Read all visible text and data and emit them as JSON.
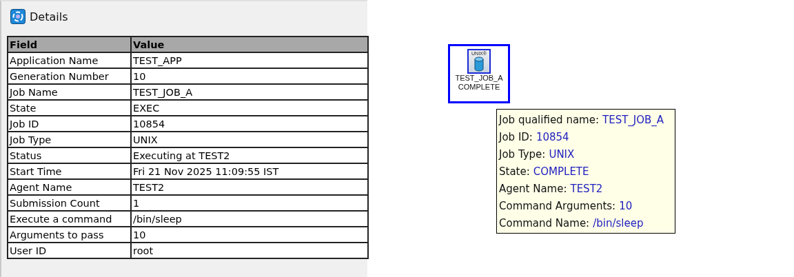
{
  "details": {
    "title": "Details",
    "columns": [
      "Field",
      "Value"
    ],
    "rows": [
      [
        "Application Name",
        "TEST_APP"
      ],
      [
        "Generation Number",
        "10"
      ],
      [
        "Job Name",
        "TEST_JOB_A"
      ],
      [
        "State",
        "EXEC"
      ],
      [
        "Job ID",
        "10854"
      ],
      [
        "Job Type",
        "UNIX"
      ],
      [
        "Status",
        "Executing at TEST2"
      ],
      [
        "Start Time",
        "Fri 21 Nov 2025 11:09:55 IST"
      ],
      [
        "Agent Name",
        "TEST2"
      ],
      [
        "Submission Count",
        "1"
      ],
      [
        "Execute a command",
        "/bin/sleep"
      ],
      [
        "Arguments to pass",
        "10"
      ],
      [
        "User ID",
        "root"
      ]
    ]
  },
  "node": {
    "badge": "UNIX®",
    "name": "TEST_JOB_A",
    "status": "COMPLETE",
    "selected": true
  },
  "tooltip": [
    {
      "label": "Job qualified name:",
      "value": "TEST_JOB_A"
    },
    {
      "label": "Job ID:",
      "value": "10854"
    },
    {
      "label": "Job Type:",
      "value": "UNIX"
    },
    {
      "label": "State:",
      "value": "COMPLETE"
    },
    {
      "label": "Agent Name:",
      "value": "TEST2"
    },
    {
      "label": "Command Arguments:",
      "value": "10"
    },
    {
      "label": "Command Name:",
      "value": "/bin/sleep"
    }
  ]
}
